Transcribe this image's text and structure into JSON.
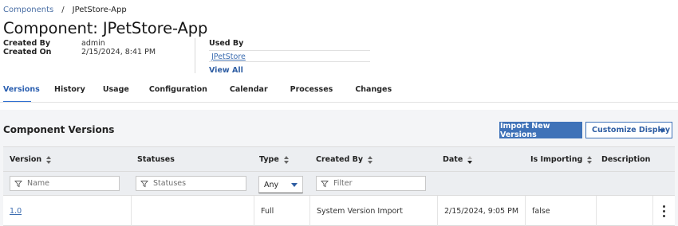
{
  "breadcrumb": {
    "root": "Components",
    "separator": "/",
    "current": "JPetStore-App"
  },
  "page_title": "Component: JPetStore-App",
  "meta": {
    "created_by_label": "Created By",
    "created_by_value": "admin",
    "created_on_label": "Created On",
    "created_on_value": "2/15/2024, 8:41 PM"
  },
  "used_by": {
    "label": "Used By",
    "link": "JPetStore",
    "view_all": "View All"
  },
  "tabs": [
    {
      "label": "Versions"
    },
    {
      "label": "History"
    },
    {
      "label": "Usage"
    },
    {
      "label": "Configuration"
    },
    {
      "label": "Calendar"
    },
    {
      "label": "Processes"
    },
    {
      "label": "Changes"
    }
  ],
  "active_tab": "Versions",
  "section": {
    "title": "Component Versions",
    "import_button": "Import New Versions",
    "customize_button": "Customize Display"
  },
  "table": {
    "columns": [
      "Version",
      "Statuses",
      "Type",
      "Created By",
      "Date",
      "Is Importing",
      "Description"
    ],
    "filters": {
      "version_placeholder": "Name",
      "statuses_placeholder": "Statuses",
      "type_value": "Any",
      "created_by_placeholder": "Filter"
    },
    "rows": [
      {
        "version": "1.0",
        "statuses": "",
        "type": "Full",
        "created_by": "System Version Import",
        "date": "2/15/2024, 9:05 PM",
        "is_importing": "false",
        "description": ""
      }
    ]
  },
  "colors": {
    "accent": "#3f72b8",
    "link": "#3b6cb0",
    "panel_bg": "#f4f5f7"
  },
  "icons": [
    "sort-icon",
    "filter-icon",
    "caret-down-icon",
    "overflow-menu-icon"
  ]
}
